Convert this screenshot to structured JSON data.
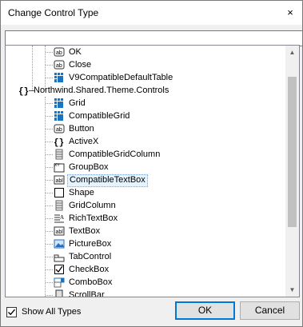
{
  "window": {
    "title": "Change Control Type",
    "close_glyph": "×"
  },
  "search": {
    "value": ""
  },
  "tree": {
    "items": [
      {
        "label": "OK",
        "icon": "textbox-ab-icon",
        "level": 2
      },
      {
        "label": "Close",
        "icon": "textbox-ab-icon",
        "level": 2
      },
      {
        "label": "V9CompatibleDefaultTable",
        "icon": "grid-icon",
        "level": 2
      },
      {
        "label": "Northwind.Shared.Theme.Controls",
        "icon": "namespace-braces-icon",
        "level": 1,
        "expanded": true
      },
      {
        "label": "Grid",
        "icon": "grid-icon",
        "level": 2
      },
      {
        "label": "CompatibleGrid",
        "icon": "grid-icon",
        "level": 2
      },
      {
        "label": "Button",
        "icon": "textbox-ab-icon",
        "level": 2
      },
      {
        "label": "ActiveX",
        "icon": "braces-icon",
        "level": 2
      },
      {
        "label": "CompatibleGridColumn",
        "icon": "grid-column-icon",
        "level": 2
      },
      {
        "label": "GroupBox",
        "icon": "groupbox-icon",
        "level": 2
      },
      {
        "label": "CompatibleTextBox",
        "icon": "textbox-abl-icon",
        "level": 2,
        "selected": true
      },
      {
        "label": "Shape",
        "icon": "shape-square-icon",
        "level": 2
      },
      {
        "label": "GridColumn",
        "icon": "grid-column-icon",
        "level": 2
      },
      {
        "label": "RichTextBox",
        "icon": "richtextbox-icon",
        "level": 2
      },
      {
        "label": "TextBox",
        "icon": "textbox-abl-icon",
        "level": 2
      },
      {
        "label": "PictureBox",
        "icon": "picture-icon",
        "level": 2
      },
      {
        "label": "TabControl",
        "icon": "tabcontrol-icon",
        "level": 2
      },
      {
        "label": "CheckBox",
        "icon": "checkbox-icon",
        "level": 2
      },
      {
        "label": "ComboBox",
        "icon": "combobox-icon",
        "level": 2
      },
      {
        "label": "ScrollBar",
        "icon": "scrollbar-icon",
        "level": 2
      }
    ]
  },
  "footer": {
    "show_all_types": {
      "label": "Show All Types",
      "checked": true
    },
    "ok_label": "OK",
    "cancel_label": "Cancel"
  },
  "colors": {
    "accent": "#0078d7",
    "selection_bg": "#e5f3ff",
    "grid_icon_blue": "#1e73be"
  }
}
